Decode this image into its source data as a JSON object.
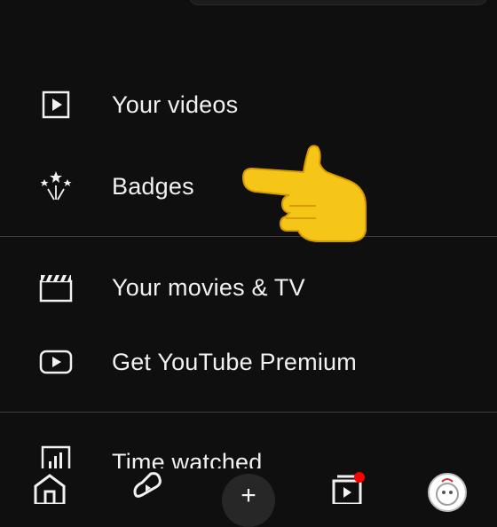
{
  "menu": {
    "items": [
      {
        "label": "Your videos",
        "icon": "video-play-icon"
      },
      {
        "label": "Badges",
        "icon": "badges-fireworks-icon"
      },
      {
        "label": "Your movies & TV",
        "icon": "clapperboard-icon"
      },
      {
        "label": "Get YouTube Premium",
        "icon": "youtube-play-icon"
      },
      {
        "label": "Time watched",
        "icon": "bar-chart-icon"
      }
    ]
  },
  "overlay": {
    "emoji": "pointing-hand-emoji"
  },
  "bottom_nav": {
    "items": [
      "home-icon",
      "shorts-icon",
      "create-icon",
      "subscriptions-icon",
      "you-avatar"
    ],
    "create_symbol": "+"
  },
  "colors": {
    "background": "#0f0f0f",
    "text": "#f1f1f1",
    "divider": "#3f3f3f",
    "notification": "#ff0000",
    "emoji": "#f5c518"
  }
}
